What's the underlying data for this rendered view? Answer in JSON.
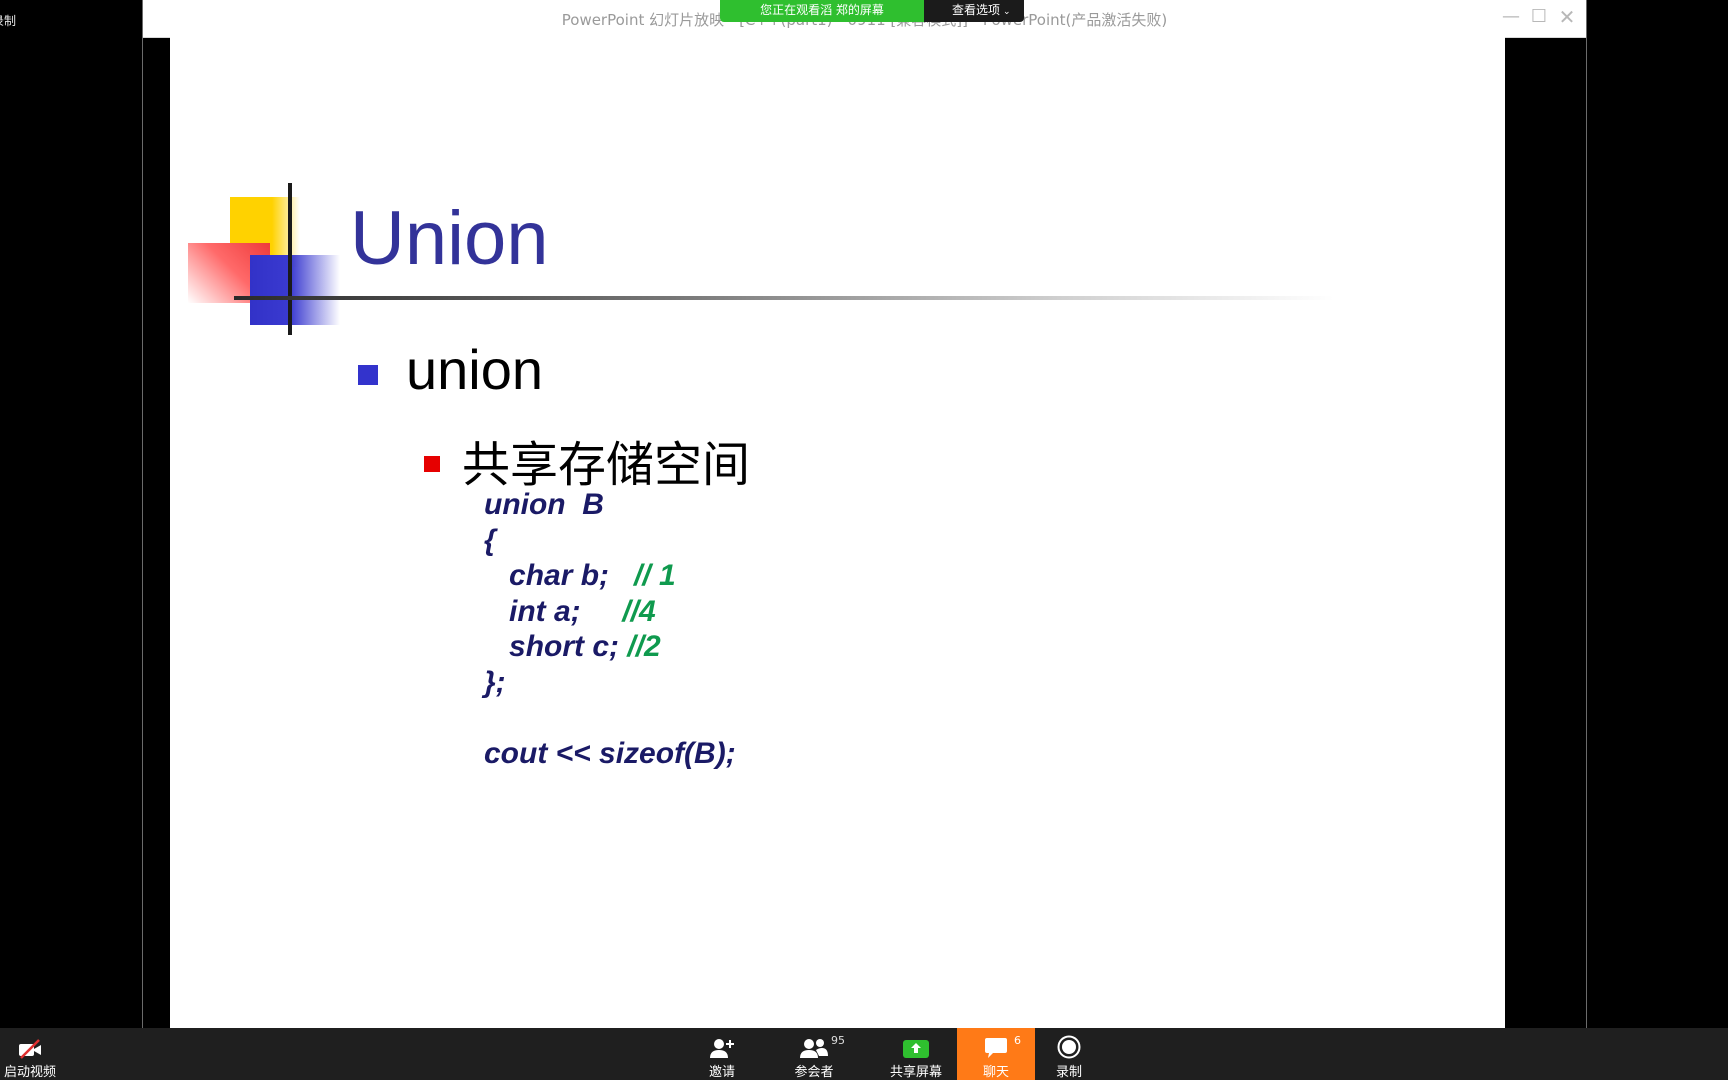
{
  "corner": {
    "label": "录制"
  },
  "window": {
    "title": "PowerPoint 幻灯片放映 - [C++(part1) - 0911 [兼容模式]] - PowerPoint(产品激活失败)",
    "minimize_glyph": "—",
    "maximize_glyph": "☐",
    "close_glyph": "✕"
  },
  "share_banner": {
    "status": "您正在观看滔 郑的屏幕",
    "view_options": "查看选项",
    "status_color": "#2fbf2f"
  },
  "slide": {
    "title": "Union",
    "title_color": "#333399",
    "bullet1": "union",
    "bullet2": "共享存储空间",
    "code": {
      "line1": "union  B",
      "line2": "{",
      "line3_code": "   char b;   ",
      "line3_comment": "// 1",
      "line4_code": "   int a;     ",
      "line4_comment": "//4",
      "line5_code": "   short c; ",
      "line5_comment": "//2",
      "line6": "};",
      "line7": "",
      "line8": "cout << sizeof(B);"
    },
    "comment_color": "#0f9a4e"
  },
  "toolbar": {
    "start_video": "启动视频",
    "invite": "邀请",
    "participants": "参会者",
    "participants_count": "95",
    "share_screen": "共享屏幕",
    "chat": "聊天",
    "chat_count": "6",
    "record": "录制",
    "chat_color": "#ff7a17"
  }
}
